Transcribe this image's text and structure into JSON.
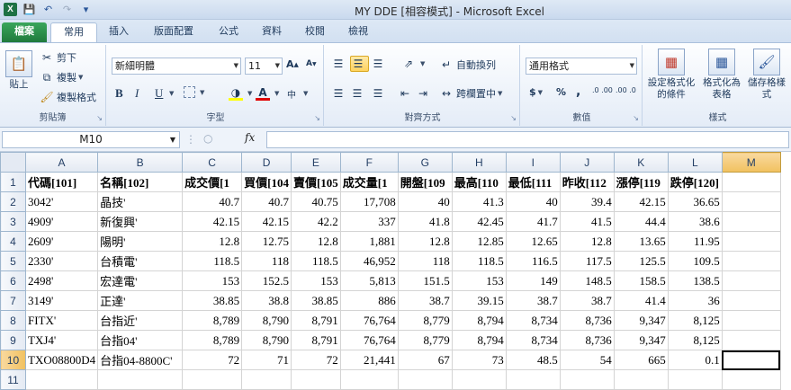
{
  "window": {
    "title": "MY DDE  [相容模式]  -  Microsoft Excel",
    "qat": [
      "save-icon",
      "undo-icon",
      "redo-icon",
      "customize-icon"
    ]
  },
  "tabs": [
    "檔案",
    "常用",
    "插入",
    "版面配置",
    "公式",
    "資料",
    "校閱",
    "檢視"
  ],
  "active_tab": "常用",
  "ribbon": {
    "clipboard": {
      "paste": "貼上",
      "cut": "剪下",
      "copy": "複製",
      "format_painter": "複製格式",
      "label": "剪貼簿"
    },
    "font": {
      "name": "新細明體",
      "size": "11",
      "bold": "B",
      "italic": "I",
      "underline": "U",
      "label": "字型"
    },
    "alignment": {
      "wrap": "自動換列",
      "merge": "跨欄置中",
      "label": "對齊方式"
    },
    "number": {
      "format": "通用格式",
      "currency": "$",
      "percent": "%",
      "comma": ",",
      "inc_dec": ".0 .00",
      "dec_dec": ".00 .0",
      "label": "數值"
    },
    "styles": {
      "conditional": "設定格式化的條件",
      "table": "格式化為表格",
      "cell": "儲存格樣式",
      "label": "樣式"
    }
  },
  "formula_bar": {
    "name_box": "M10",
    "fx": "fx",
    "value": ""
  },
  "sheet": {
    "columns": [
      "A",
      "B",
      "C",
      "D",
      "E",
      "F",
      "G",
      "H",
      "I",
      "J",
      "K",
      "L",
      "M"
    ],
    "active_column": "M",
    "active_row": 10,
    "rows": [
      [
        "代碼[101]",
        "名稱[102]",
        "成交價[1",
        "買價[104",
        "賣價[105",
        "成交量[1",
        "開盤[109",
        "最高[110",
        "最低[111",
        "昨收[112",
        "漲停[119",
        "跌停[120]",
        ""
      ],
      [
        "3042'",
        "晶技'",
        "40.7",
        "40.7",
        "40.75",
        "17,708",
        "40",
        "41.3",
        "40",
        "39.4",
        "42.15",
        "36.65",
        ""
      ],
      [
        "4909'",
        "新復興'",
        "42.15",
        "42.15",
        "42.2",
        "337",
        "41.8",
        "42.45",
        "41.7",
        "41.5",
        "44.4",
        "38.6",
        ""
      ],
      [
        "2609'",
        "陽明'",
        "12.8",
        "12.75",
        "12.8",
        "1,881",
        "12.8",
        "12.85",
        "12.65",
        "12.8",
        "13.65",
        "11.95",
        ""
      ],
      [
        "2330'",
        "台積電'",
        "118.5",
        "118",
        "118.5",
        "46,952",
        "118",
        "118.5",
        "116.5",
        "117.5",
        "125.5",
        "109.5",
        ""
      ],
      [
        "2498'",
        "宏達電'",
        "153",
        "152.5",
        "153",
        "5,813",
        "151.5",
        "153",
        "149",
        "148.5",
        "158.5",
        "138.5",
        ""
      ],
      [
        "3149'",
        "正達'",
        "38.85",
        "38.8",
        "38.85",
        "886",
        "38.7",
        "39.15",
        "38.7",
        "38.7",
        "41.4",
        "36",
        ""
      ],
      [
        "FITX'",
        "台指近'",
        "8,789",
        "8,790",
        "8,791",
        "76,764",
        "8,779",
        "8,794",
        "8,734",
        "8,736",
        "9,347",
        "8,125",
        ""
      ],
      [
        "TXJ4'",
        "台指04'",
        "8,789",
        "8,790",
        "8,791",
        "76,764",
        "8,779",
        "8,794",
        "8,734",
        "8,736",
        "9,347",
        "8,125",
        ""
      ],
      [
        "TXO08800D4",
        "台指04-8800C'",
        "72",
        "71",
        "72",
        "21,441",
        "67",
        "73",
        "48.5",
        "54",
        "665",
        "0.1",
        ""
      ],
      [
        "",
        "",
        "",
        "",
        "",
        "",
        "",
        "",
        "",
        "",
        "",
        "",
        ""
      ]
    ]
  }
}
